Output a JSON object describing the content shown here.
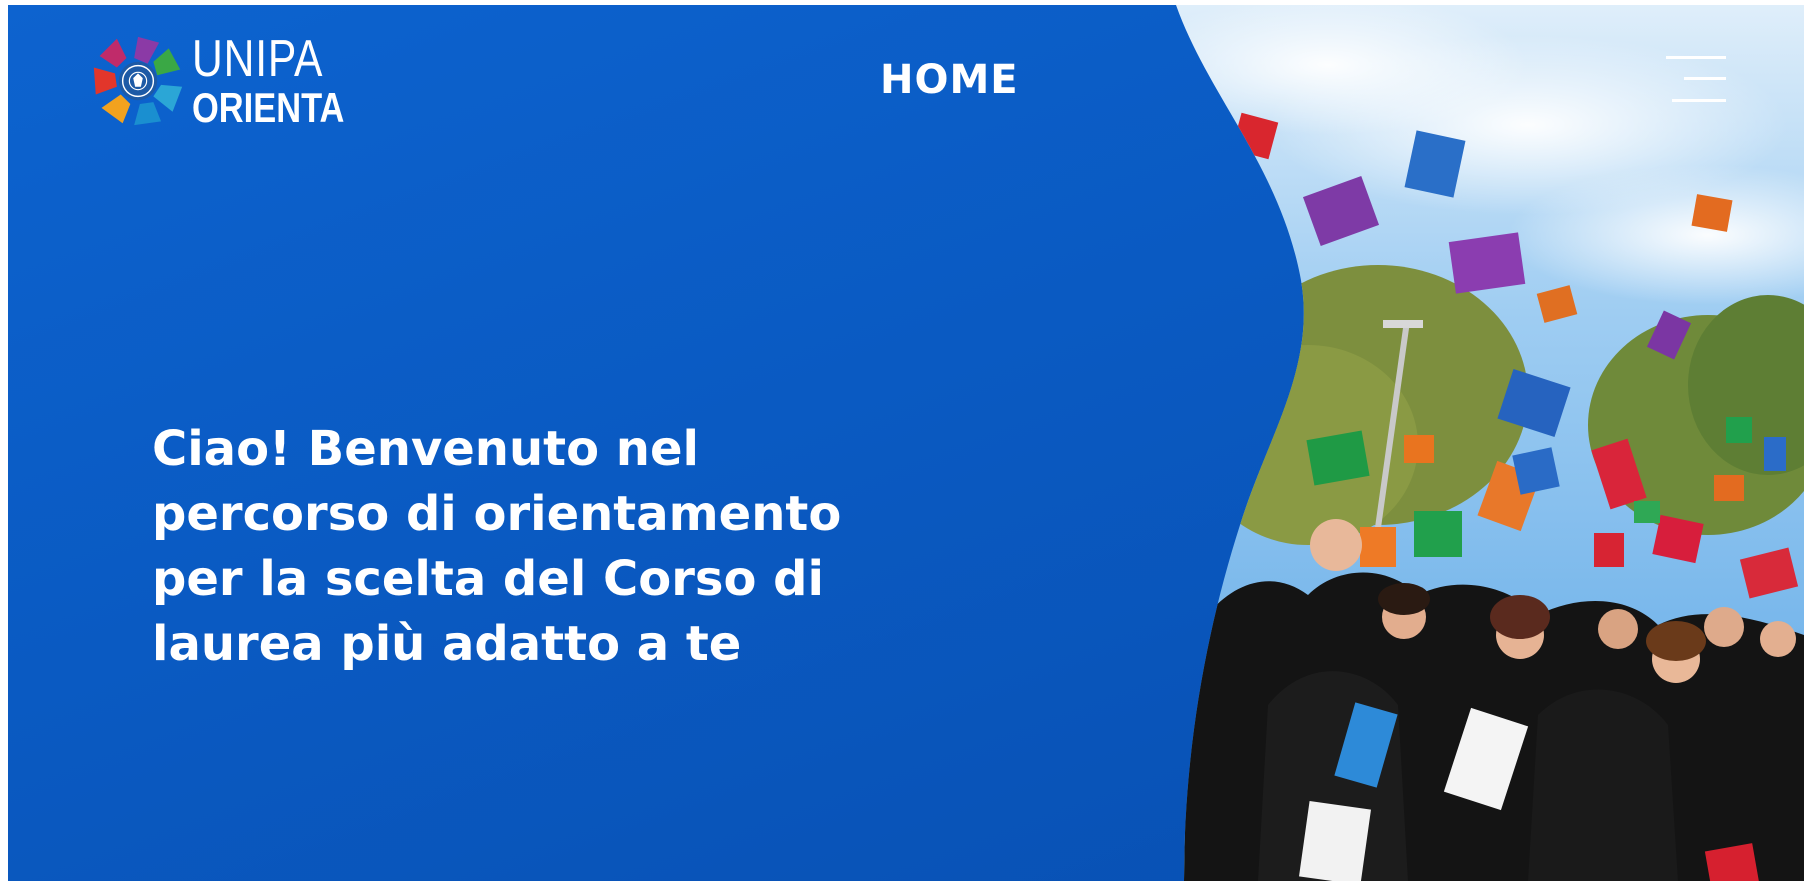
{
  "brand": {
    "line1": "UNIPA",
    "line2": "ORIENTA"
  },
  "nav": {
    "home_label": "HOME"
  },
  "hero": {
    "lines": [
      "Ciao! Benvenuto nel",
      "percorso di orientamento",
      "per la scelta del Corso di",
      "laurea più adatto a te"
    ]
  },
  "icons": {
    "menu": "hamburger-menu-icon",
    "logo": "unipa-seal-logo-icon"
  },
  "colors": {
    "primary_blue": "#0a5ac2",
    "text": "#ffffff",
    "sky": "#8ec3ee",
    "gown": "#141414"
  }
}
